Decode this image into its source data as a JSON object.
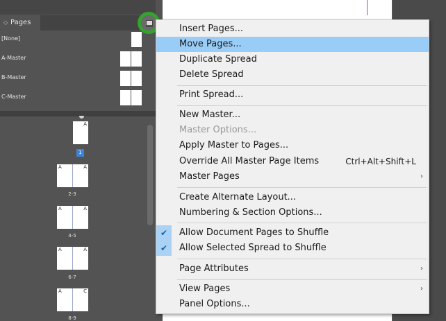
{
  "panel": {
    "tab_label": "Pages",
    "tab_arrow": "◇",
    "masters": [
      {
        "label": "[None]"
      },
      {
        "label": "A-Master"
      },
      {
        "label": "B-Master"
      },
      {
        "label": "C-Master"
      }
    ],
    "pages": [
      {
        "master_left": "",
        "master_right": "A",
        "number": "1"
      },
      {
        "master_left": "A",
        "master_right": "A",
        "number": "2-3"
      },
      {
        "master_left": "A",
        "master_right": "A",
        "number": "4-5"
      },
      {
        "master_left": "A",
        "master_right": "A",
        "number": "6-7"
      },
      {
        "master_left": "A",
        "master_right": "C",
        "number": "8-9"
      }
    ]
  },
  "menu": {
    "items": [
      {
        "label": "Insert Pages..."
      },
      {
        "label": "Move Pages..."
      },
      {
        "label": "Duplicate Spread"
      },
      {
        "label": "Delete Spread"
      },
      {
        "label": "Print Spread..."
      },
      {
        "label": "New Master..."
      },
      {
        "label": "Master Options..."
      },
      {
        "label": "Apply Master to Pages..."
      },
      {
        "label": "Override All Master Page Items",
        "shortcut": "Ctrl+Alt+Shift+L"
      },
      {
        "label": "Master Pages"
      },
      {
        "label": "Create Alternate Layout..."
      },
      {
        "label": "Numbering & Section Options..."
      },
      {
        "label": "Allow Document Pages to Shuffle"
      },
      {
        "label": "Allow Selected Spread to Shuffle"
      },
      {
        "label": "Page Attributes"
      },
      {
        "label": "View Pages"
      },
      {
        "label": "Panel Options..."
      }
    ],
    "submenu_arrow": "›",
    "check_mark": "✔"
  },
  "colors": {
    "highlight": "#99ccf6",
    "callout_ring": "#35a22f",
    "page_number_active": "#3d84d6"
  }
}
